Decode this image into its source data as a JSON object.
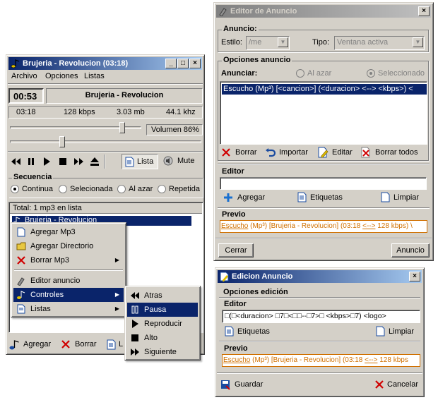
{
  "player": {
    "title": "Brujeria - Revolucion (03:18)",
    "menu": [
      "Archivo",
      "Opciones",
      "Listas"
    ],
    "time": "00:53",
    "track": "Brujeria - Revolucion",
    "duration": "03:18",
    "bitrate": "128 kbps",
    "size": "3.03 mb",
    "freq": "44.1 khz",
    "volume_label": "Volumen 86%",
    "volume": 0.86,
    "seek": 0.27,
    "lista_label": "Lista",
    "mute_label": "Mute",
    "secuencia": "Secuencia",
    "seq_options": [
      "Continua",
      "Selecionada",
      "Al azar",
      "Repetida"
    ],
    "total": "Total: 1 mp3 en lista",
    "playlist": [
      "Brujeria - Revolucion"
    ],
    "bottom": [
      "Agregar",
      "Borrar",
      "L"
    ]
  },
  "context_menu": {
    "items": [
      "Agregar Mp3",
      "Agregar Directorio",
      "Borrar Mp3",
      "Editor anuncio",
      "Controles",
      "Listas"
    ],
    "submenu": [
      "Atras",
      "Pausa",
      "Reproducir",
      "Alto",
      "Siguiente"
    ]
  },
  "editor": {
    "title": "Editor de Anuncio",
    "anuncio_group": "Anuncio:",
    "estilo_label": "Estilo:",
    "estilo_value": "/me",
    "tipo_label": "Tipo:",
    "tipo_value": "Ventana activa",
    "opciones_group": "Opciones anuncio",
    "anunciar_label": "Anunciar:",
    "al_azar": "Al azar",
    "seleccionado": "Seleccionado",
    "list_item": "Escucho (Mp³) [<cancion>] (<duracion> <--> <kbps>) <",
    "actions": [
      "Borrar",
      "Importar",
      "Editar",
      "Borrar todos"
    ],
    "editor_label": "Editor",
    "editor_actions": [
      "Agregar",
      "Etiquetas",
      "Limpiar"
    ],
    "previo_label": "Previo",
    "preview_parts": [
      "Escucho",
      "(Mp³)",
      "[Brujeria - Revolucion]",
      "(03:18",
      "<-->",
      "128 kbps)",
      "\\"
    ],
    "cerrar": "Cerrar",
    "anuncio_btn": "Anuncio"
  },
  "edicion": {
    "title": "Edicion Anuncio",
    "group": "Opciones edición",
    "editor_label": "Editor",
    "editor_value": "□(□<duracion> □7□<□□--□7>□ <kbps>□7) <logo>",
    "etiquetas": "Etiquetas",
    "limpiar": "Limpiar",
    "previo_label": "Previo",
    "preview_parts": [
      "Escucho",
      "(Mp³)",
      "[Brujeria - Revolucion]",
      "(03:18",
      "<-->",
      "128 kbps"
    ],
    "guardar": "Guardar",
    "cancelar": "Cancelar"
  },
  "colors": {
    "titlebar": "#0a246a",
    "accent_orange": "#d07000",
    "face": "#d4d0c8",
    "selection": "#0a246a"
  }
}
